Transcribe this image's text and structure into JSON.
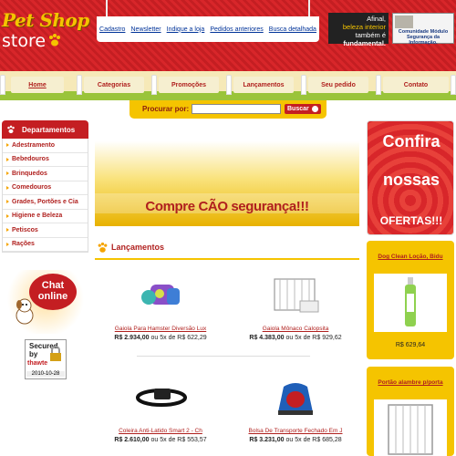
{
  "header": {
    "logo_line1": "Pet Shop",
    "logo_line2": "store",
    "links": [
      "Cadastro",
      "Newsletter",
      "Indique a loja",
      "Pedidos anteriores",
      "Busca detalhada"
    ],
    "slogan": {
      "line1": "Afinal,",
      "line2": "beleza interior",
      "line3": "também é",
      "line4": "fundamental."
    },
    "seal_text": "Comunidade Módulo Segurança da Informação."
  },
  "nav": {
    "tabs": [
      "Home",
      "Categorias",
      "Promoções",
      "Lançamentos",
      "Seu pedido",
      "Contato"
    ],
    "active": "Home"
  },
  "search": {
    "label": "Procurar por:",
    "value": "",
    "button": "Buscar"
  },
  "sidebar": {
    "title": "Departamentos",
    "items": [
      "Adestramento",
      "Bebedouros",
      "Brinquedos",
      "Comedouros",
      "Grades, Portões e Cia",
      "Higiene e Beleza",
      "Petiscos",
      "Rações"
    ],
    "chat": {
      "line1": "Chat",
      "line2": "online"
    },
    "secured": {
      "line1": "Secured",
      "line2": "by",
      "brand": "thawte",
      "date": "2010-10-28"
    }
  },
  "banner": {
    "text": "Compre CÃO segurança!!!"
  },
  "lancamentos": {
    "title": "Lançamentos",
    "products": [
      {
        "name": "Gaiola Para Hamster Diversão Lux",
        "price": "R$ 2.934,00",
        "installments": "ou 5x de R$ 622,29"
      },
      {
        "name": "Gaiola Mônaco Calopsita",
        "price": "R$ 4.383,00",
        "installments": "ou 5x de R$ 929,62"
      },
      {
        "name": "Coleira Anti-Latido Smart 2 - Ch",
        "price": "R$ 2.610,00",
        "installments": "ou 5x de R$ 553,57"
      },
      {
        "name": "Bolsa De Transporte Fechado Em J",
        "price": "R$ 3.231,00",
        "installments": "ou 5x de R$ 685,28"
      }
    ]
  },
  "right": {
    "promo": {
      "line1": "Confira",
      "line2": "nossas",
      "line3": "OFERTAS!!!"
    },
    "products": [
      {
        "name": "Dog Clean Loção, Bidu",
        "price": "R$ 629,64"
      },
      {
        "name": "Portão alambre p/porta",
        "price": ""
      }
    ]
  },
  "colors": {
    "brand_red": "#c41e22",
    "brand_yellow": "#f5c400",
    "link_blue": "#003399"
  }
}
